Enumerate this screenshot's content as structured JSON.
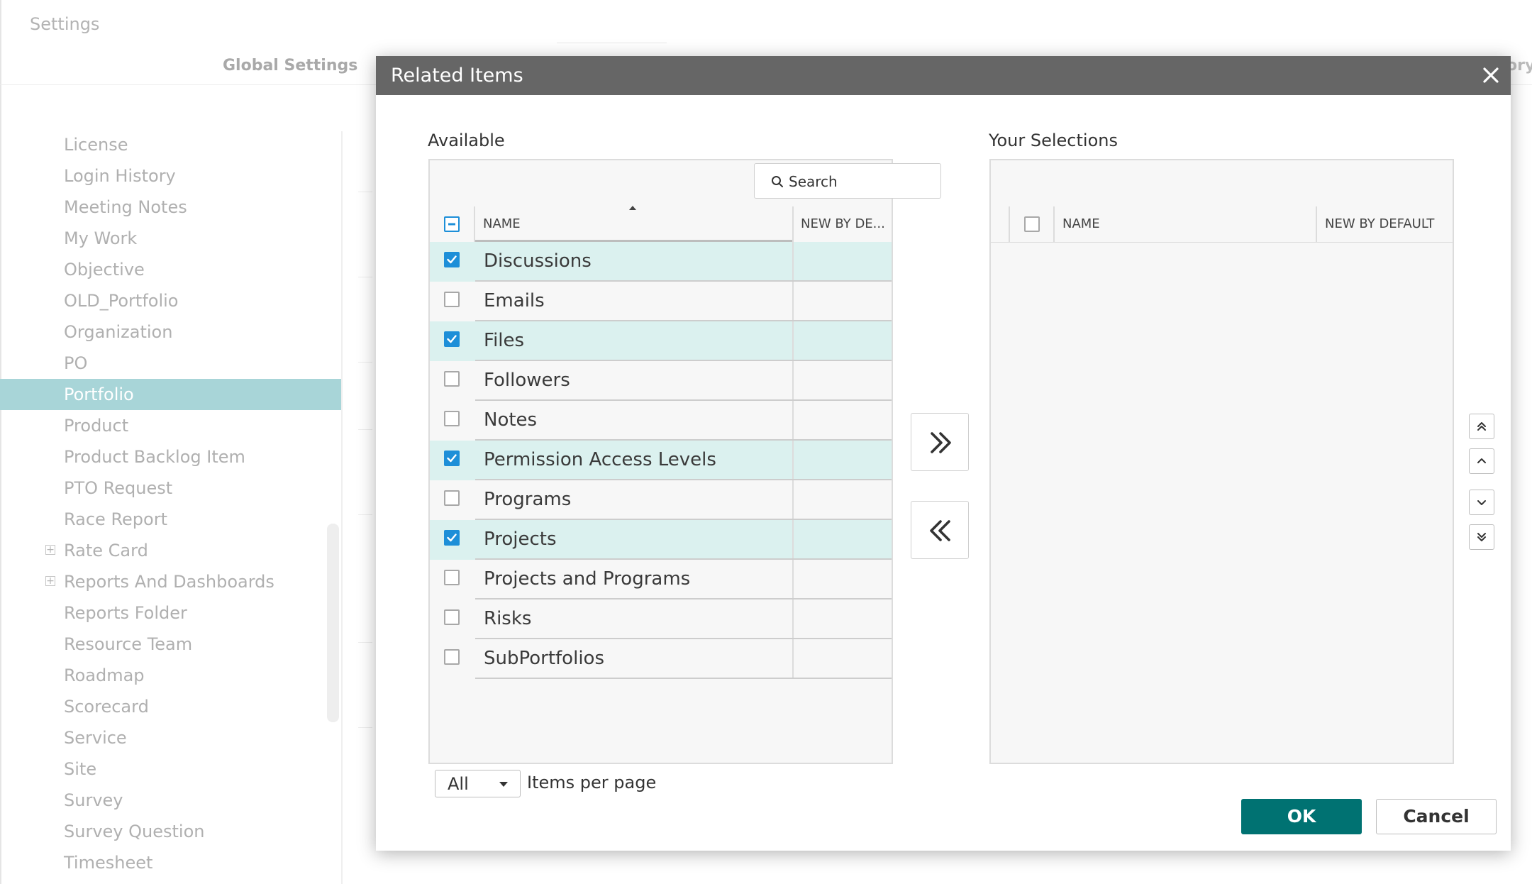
{
  "app": {
    "title": "Settings"
  },
  "tabs": {
    "global_settings": "Global Settings",
    "right_partial": "ory"
  },
  "sidebar": {
    "items": [
      {
        "label": "License",
        "active": false,
        "expandable": false
      },
      {
        "label": "Login History",
        "active": false,
        "expandable": false
      },
      {
        "label": "Meeting Notes",
        "active": false,
        "expandable": false
      },
      {
        "label": "My Work",
        "active": false,
        "expandable": false
      },
      {
        "label": "Objective",
        "active": false,
        "expandable": false
      },
      {
        "label": "OLD_Portfolio",
        "active": false,
        "expandable": false
      },
      {
        "label": "Organization",
        "active": false,
        "expandable": false
      },
      {
        "label": "PO",
        "active": false,
        "expandable": false
      },
      {
        "label": "Portfolio",
        "active": true,
        "expandable": false
      },
      {
        "label": "Product",
        "active": false,
        "expandable": false
      },
      {
        "label": "Product Backlog Item",
        "active": false,
        "expandable": false
      },
      {
        "label": "PTO Request",
        "active": false,
        "expandable": false
      },
      {
        "label": "Race Report",
        "active": false,
        "expandable": false
      },
      {
        "label": "Rate Card",
        "active": false,
        "expandable": true
      },
      {
        "label": "Reports And Dashboards",
        "active": false,
        "expandable": true
      },
      {
        "label": "Reports Folder",
        "active": false,
        "expandable": false
      },
      {
        "label": "Resource Team",
        "active": false,
        "expandable": false
      },
      {
        "label": "Roadmap",
        "active": false,
        "expandable": false
      },
      {
        "label": "Scorecard",
        "active": false,
        "expandable": false
      },
      {
        "label": "Service",
        "active": false,
        "expandable": false
      },
      {
        "label": "Site",
        "active": false,
        "expandable": false
      },
      {
        "label": "Survey",
        "active": false,
        "expandable": false
      },
      {
        "label": "Survey Question",
        "active": false,
        "expandable": false
      },
      {
        "label": "Timesheet",
        "active": false,
        "expandable": false
      }
    ]
  },
  "dialog": {
    "title": "Related Items",
    "available": {
      "label": "Available",
      "search_label": "Search",
      "columns": {
        "name": "NAME",
        "new_by_default": "NEW BY DE..."
      },
      "select_all_state": "partial",
      "rows": [
        {
          "name": "Discussions",
          "checked": true
        },
        {
          "name": "Emails",
          "checked": false
        },
        {
          "name": "Files",
          "checked": true
        },
        {
          "name": "Followers",
          "checked": false
        },
        {
          "name": "Notes",
          "checked": false
        },
        {
          "name": "Permission Access Levels",
          "checked": true
        },
        {
          "name": "Programs",
          "checked": false
        },
        {
          "name": "Projects",
          "checked": true
        },
        {
          "name": "Projects and Programs",
          "checked": false
        },
        {
          "name": "Risks",
          "checked": false
        },
        {
          "name": "SubPortfolios",
          "checked": false
        }
      ]
    },
    "selections": {
      "label": "Your Selections",
      "columns": {
        "name": "NAME",
        "new_by_default": "NEW BY DEFAULT"
      },
      "rows": []
    },
    "pager": {
      "page_size": "All",
      "label": "Items per page"
    },
    "buttons": {
      "ok": "OK",
      "cancel": "Cancel"
    }
  },
  "colors": {
    "titlebar": "#666666",
    "active_sidebar": "#a8d5d8",
    "selected_row": "#dbf1ef",
    "checkbox_on": "#1d8fd8",
    "ok_button": "#007272"
  }
}
